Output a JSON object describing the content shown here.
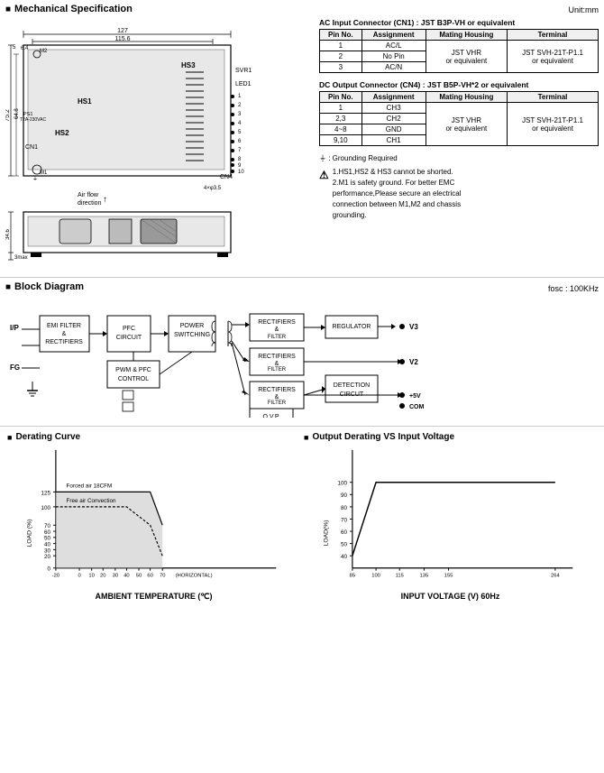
{
  "mechanical": {
    "title": "Mechanical Specification",
    "unit": "Unit:mm",
    "dimensions": {
      "width_top": "127",
      "width_mid": "115.6",
      "height_left": "75.2",
      "height_sub": "64.8",
      "height_top": "6.4",
      "height_bottom": "34.6",
      "height_foot": "3max",
      "hole_dim": "4×φ3.5"
    }
  },
  "ac_connector": {
    "title": "AC Input Connector (CN1) : JST B3P-VH or equivalent",
    "headers": [
      "Pin No.",
      "Assignment",
      "Mating Housing",
      "Terminal"
    ],
    "rows": [
      [
        "1",
        "AC/L",
        "",
        ""
      ],
      [
        "2",
        "No Pin",
        "JST VHR or equivalent",
        "JST SVH-21T-P1.1 or equivalent"
      ],
      [
        "3",
        "AC/N",
        "",
        ""
      ]
    ]
  },
  "dc_connector": {
    "title": "DC Output Connector (CN4) : JST B5P-VH*2 or equivalent",
    "headers": [
      "Pin No.",
      "Assignment",
      "Mating Housing",
      "Terminal"
    ],
    "rows": [
      [
        "1",
        "CH3",
        "",
        ""
      ],
      [
        "2,3",
        "CH2",
        "JST VHR or equivalent",
        "JST SVH-21T-P1.1 or equivalent"
      ],
      [
        "4~8",
        "GND",
        "",
        ""
      ],
      [
        "9,10",
        "CH1",
        "",
        ""
      ]
    ]
  },
  "notes": {
    "grounding": "⏚ : Grounding Required",
    "warnings": [
      "1.HS1,HS2 & HS3 cannot be shorted.",
      "2.M1 is safety ground. For better EMC performance,Please secure an electrical connection between M1,M2 and chassis grounding."
    ]
  },
  "block_diagram": {
    "title": "Block Diagram",
    "fosc": "fosc : 100KHz",
    "blocks": [
      {
        "id": "ip",
        "label": "I/P"
      },
      {
        "id": "fg",
        "label": "FG"
      },
      {
        "id": "emi",
        "label": "EMI FILTER\n& \nRECTIFIERS"
      },
      {
        "id": "pfc",
        "label": "PFC\nCIRCUIT"
      },
      {
        "id": "pwr_sw",
        "label": "POWER\nSWITCHING"
      },
      {
        "id": "pwm",
        "label": "PWM & PFC\nCONTROL"
      },
      {
        "id": "rect1",
        "label": "RECTIFIERS\n&\nFILTER"
      },
      {
        "id": "rect2",
        "label": "RECTIFIERS\n&\nFILTER"
      },
      {
        "id": "rect3",
        "label": "RECTIFIERS\n&\nFILTER"
      },
      {
        "id": "reg",
        "label": "REGULATOR"
      },
      {
        "id": "det",
        "label": "DETECTION\nCIRCUT"
      },
      {
        "id": "ovp",
        "label": "O.V.P."
      },
      {
        "id": "v3",
        "label": "V3"
      },
      {
        "id": "v2",
        "label": "V2"
      },
      {
        "id": "5v",
        "label": "+5V"
      },
      {
        "id": "com",
        "label": "COM"
      }
    ]
  },
  "derating_curve": {
    "title": "Derating Curve",
    "xlabel": "AMBIENT TEMPERATURE (℃)",
    "ylabel": "LOAD (%)",
    "labels": {
      "forced": "Forced air 18CFM",
      "free": "Free air Convection"
    },
    "x_ticks": [
      "-20",
      "0",
      "10",
      "20",
      "30",
      "40",
      "50",
      "60",
      "70"
    ],
    "y_ticks": [
      "0",
      "20",
      "30",
      "40",
      "50",
      "60",
      "70",
      "100",
      "125"
    ],
    "x_label_end": "70 (HORIZONTAL)"
  },
  "output_derating": {
    "title": "Output Derating VS Input Voltage",
    "xlabel": "INPUT VOLTAGE (V) 60Hz",
    "ylabel": "LOAD(%)",
    "x_ticks": [
      "85",
      "100",
      "115",
      "135",
      "155",
      "264"
    ],
    "y_ticks": [
      "40",
      "50",
      "60",
      "70",
      "80",
      "90",
      "100"
    ]
  }
}
